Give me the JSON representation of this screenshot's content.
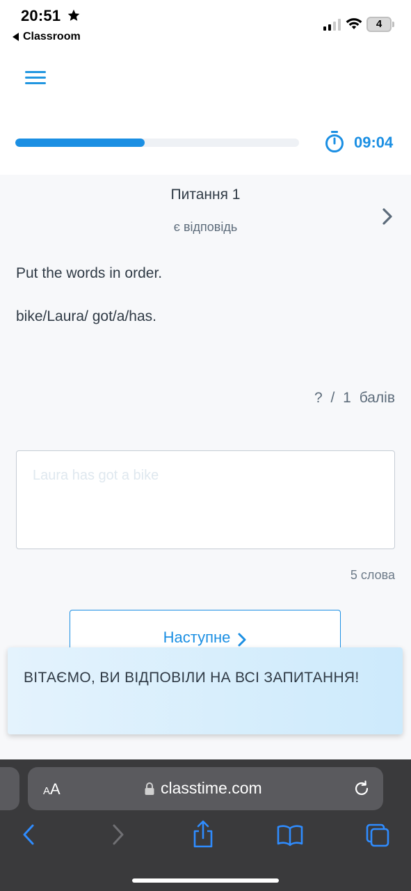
{
  "status_bar": {
    "time": "20:51",
    "back_app": "Classroom",
    "battery": "4"
  },
  "header": {
    "progress_fraction": 0.455,
    "timer": "09:04"
  },
  "question": {
    "title": "Питання 1",
    "status": "є відповідь",
    "instruction": "Put the words in order.",
    "words": "bike/Laura/ got/a/has.",
    "score": "? / 1 балів"
  },
  "answer": {
    "value": "Laura has got a bike",
    "word_count": "5 слова"
  },
  "next_button": {
    "label": "Наступне"
  },
  "toast": {
    "text": "ВІТАЄМО, ВИ ВІДПОВІЛИ НА ВСІ ЗАПИТАННЯ!"
  },
  "browser": {
    "aa_small": "A",
    "aa_large": "A",
    "url": "classtime.com"
  },
  "colors": {
    "accent": "#1b8fe3",
    "toast_bg": "#d6eefc",
    "browser_bar": "#3a3a3c"
  }
}
